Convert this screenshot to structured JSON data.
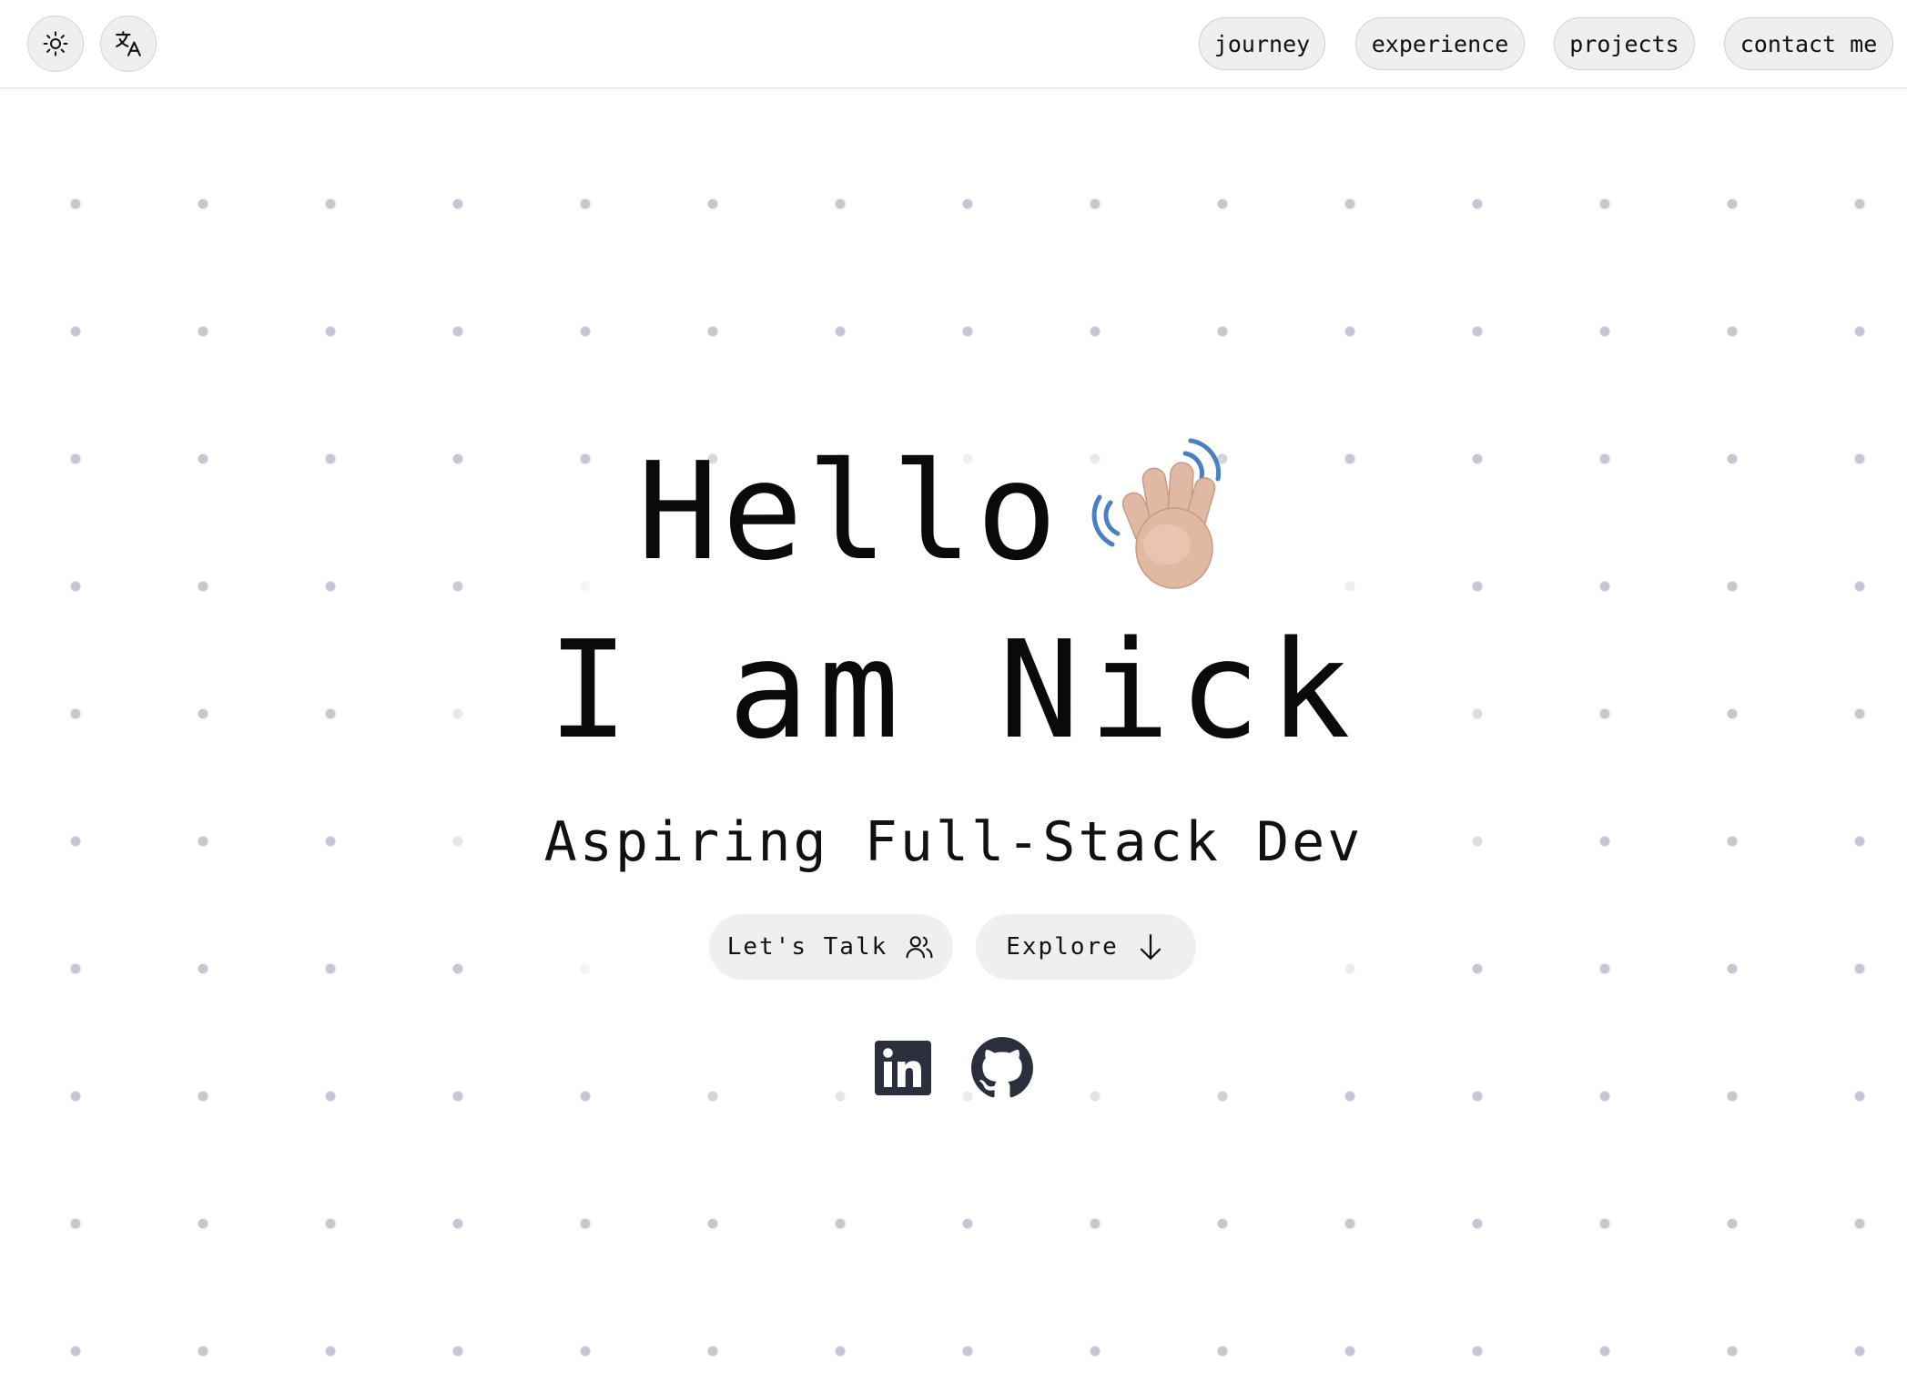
{
  "header": {
    "theme_toggle_icon": "sun-icon",
    "language_toggle_icon": "translate-icon",
    "nav": [
      {
        "label": "journey"
      },
      {
        "label": "experience"
      },
      {
        "label": "projects"
      },
      {
        "label": "contact me"
      }
    ]
  },
  "hero": {
    "greeting": "Hello",
    "greeting_emoji": "waving-hand-icon",
    "name_line": "I am Nick",
    "tagline": "Aspiring Full-Stack Dev",
    "buttons": {
      "talk_label": "Let's Talk",
      "talk_icon": "users-icon",
      "explore_label": "Explore",
      "explore_icon": "arrow-down-icon"
    }
  },
  "social": {
    "linkedin_icon": "linkedin-icon",
    "github_icon": "github-icon"
  },
  "colors": {
    "background": "#ffffff",
    "dot": "#c3c8d2",
    "pill": "#efefef",
    "text": "#0a0a0a",
    "social_icon": "#2b2f3d"
  }
}
